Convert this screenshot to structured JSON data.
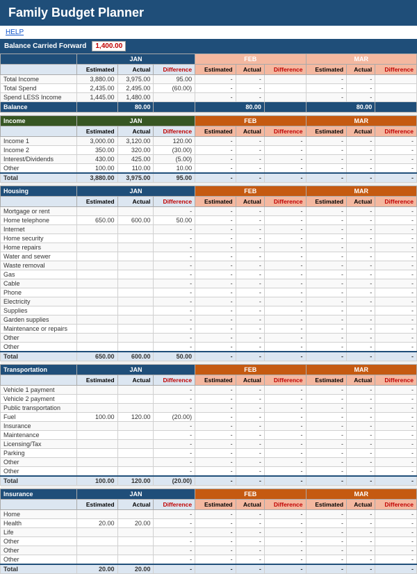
{
  "header": {
    "title": "Family Budget Planner",
    "help_label": "HELP"
  },
  "balance_forward": {
    "label": "Balance Carried Forward",
    "value": "1,400.00"
  },
  "columns": {
    "jan": "JAN",
    "feb": "FEB",
    "mar": "MAR",
    "estimated": "Estimated",
    "actual": "Actual",
    "difference": "Difference"
  },
  "summary": {
    "rows": [
      {
        "label": "Total Income",
        "jan_est": "3,880.00",
        "jan_act": "3,975.00",
        "jan_diff": "95.00",
        "jan_diff_cls": ""
      },
      {
        "label": "Total Spend",
        "jan_est": "2,435.00",
        "jan_act": "2,495.00",
        "jan_diff": "(60.00)",
        "jan_diff_cls": "diff-neg"
      },
      {
        "label": "Spend LESS Income",
        "jan_est": "1,445.00",
        "jan_act": "1,480.00",
        "jan_diff": "",
        "jan_diff_cls": ""
      }
    ],
    "balance": {
      "label": "Balance",
      "jan": "80.00",
      "feb": "80.00",
      "mar": "80.00"
    }
  },
  "income": {
    "section_label": "Income",
    "rows": [
      {
        "label": "Income 1",
        "jan_est": "3,000.00",
        "jan_act": "3,120.00",
        "jan_diff": "120.00",
        "jan_diff_cls": ""
      },
      {
        "label": "Income 2",
        "jan_est": "350.00",
        "jan_act": "320.00",
        "jan_diff": "(30.00)",
        "jan_diff_cls": "diff-neg"
      },
      {
        "label": "Interest/Dividends",
        "jan_est": "430.00",
        "jan_act": "425.00",
        "jan_diff": "(5.00)",
        "jan_diff_cls": "diff-neg"
      },
      {
        "label": "Other",
        "jan_est": "100.00",
        "jan_act": "110.00",
        "jan_diff": "10.00",
        "jan_diff_cls": ""
      }
    ],
    "total": {
      "label": "Total",
      "jan_est": "3,880.00",
      "jan_act": "3,975.00",
      "jan_diff": "95.00",
      "jan_diff_cls": ""
    }
  },
  "housing": {
    "section_label": "Housing",
    "rows": [
      {
        "label": "Mortgage or rent",
        "jan_est": "",
        "jan_act": "",
        "jan_diff": "-"
      },
      {
        "label": "Home telephone",
        "jan_est": "650.00",
        "jan_act": "600.00",
        "jan_diff": "50.00"
      },
      {
        "label": "Internet",
        "jan_est": "",
        "jan_act": "",
        "jan_diff": "-"
      },
      {
        "label": "Home security",
        "jan_est": "",
        "jan_act": "",
        "jan_diff": "-"
      },
      {
        "label": "Home repairs",
        "jan_est": "",
        "jan_act": "",
        "jan_diff": "-"
      },
      {
        "label": "Water and sewer",
        "jan_est": "",
        "jan_act": "",
        "jan_diff": "-"
      },
      {
        "label": "Waste removal",
        "jan_est": "",
        "jan_act": "",
        "jan_diff": "-"
      },
      {
        "label": "Gas",
        "jan_est": "",
        "jan_act": "",
        "jan_diff": "-"
      },
      {
        "label": "Cable",
        "jan_est": "",
        "jan_act": "",
        "jan_diff": "-"
      },
      {
        "label": "Phone",
        "jan_est": "",
        "jan_act": "",
        "jan_diff": "-"
      },
      {
        "label": "Electricity",
        "jan_est": "",
        "jan_act": "",
        "jan_diff": "-"
      },
      {
        "label": "Supplies",
        "jan_est": "",
        "jan_act": "",
        "jan_diff": "-"
      },
      {
        "label": "Garden supplies",
        "jan_est": "",
        "jan_act": "",
        "jan_diff": "-"
      },
      {
        "label": "Maintenance or repairs",
        "jan_est": "",
        "jan_act": "",
        "jan_diff": "-"
      },
      {
        "label": "Other",
        "jan_est": "",
        "jan_act": "",
        "jan_diff": "-"
      },
      {
        "label": "Other",
        "jan_est": "",
        "jan_act": "",
        "jan_diff": "-"
      }
    ],
    "total": {
      "label": "Total",
      "jan_est": "650.00",
      "jan_act": "600.00",
      "jan_diff": "50.00"
    }
  },
  "transportation": {
    "section_label": "Transportation",
    "rows": [
      {
        "label": "Vehicle 1 payment",
        "jan_est": "",
        "jan_act": "",
        "jan_diff": "-"
      },
      {
        "label": "Vehicle 2 payment",
        "jan_est": "",
        "jan_act": "",
        "jan_diff": "-"
      },
      {
        "label": "Public transportation",
        "jan_est": "",
        "jan_act": "",
        "jan_diff": "-"
      },
      {
        "label": "Fuel",
        "jan_est": "100.00",
        "jan_act": "120.00",
        "jan_diff": "(20.00)",
        "jan_diff_cls": "diff-neg"
      },
      {
        "label": "Insurance",
        "jan_est": "",
        "jan_act": "",
        "jan_diff": "-"
      },
      {
        "label": "Maintenance",
        "jan_est": "",
        "jan_act": "",
        "jan_diff": "-"
      },
      {
        "label": "Licensing/Tax",
        "jan_est": "",
        "jan_act": "",
        "jan_diff": "-"
      },
      {
        "label": "Parking",
        "jan_est": "",
        "jan_act": "",
        "jan_diff": "-"
      },
      {
        "label": "Other",
        "jan_est": "",
        "jan_act": "",
        "jan_diff": "-"
      },
      {
        "label": "Other",
        "jan_est": "",
        "jan_act": "",
        "jan_diff": "-"
      }
    ],
    "total": {
      "label": "Total",
      "jan_est": "100.00",
      "jan_act": "120.00",
      "jan_diff": "(20.00)",
      "jan_diff_cls": "diff-neg"
    }
  },
  "insurance": {
    "section_label": "Insurance",
    "rows": [
      {
        "label": "Home",
        "jan_est": "",
        "jan_act": "",
        "jan_diff": "-"
      },
      {
        "label": "Health",
        "jan_est": "20.00",
        "jan_act": "20.00",
        "jan_diff": "-"
      },
      {
        "label": "Life",
        "jan_est": "",
        "jan_act": "",
        "jan_diff": "-"
      },
      {
        "label": "Other",
        "jan_est": "",
        "jan_act": "",
        "jan_diff": "-"
      },
      {
        "label": "Other",
        "jan_est": "",
        "jan_act": "",
        "jan_diff": "-"
      },
      {
        "label": "Other",
        "jan_est": "",
        "jan_act": "",
        "jan_diff": "-"
      }
    ],
    "total": {
      "label": "Total",
      "jan_est": "20.00",
      "jan_act": "20.00",
      "jan_diff": "-"
    }
  }
}
